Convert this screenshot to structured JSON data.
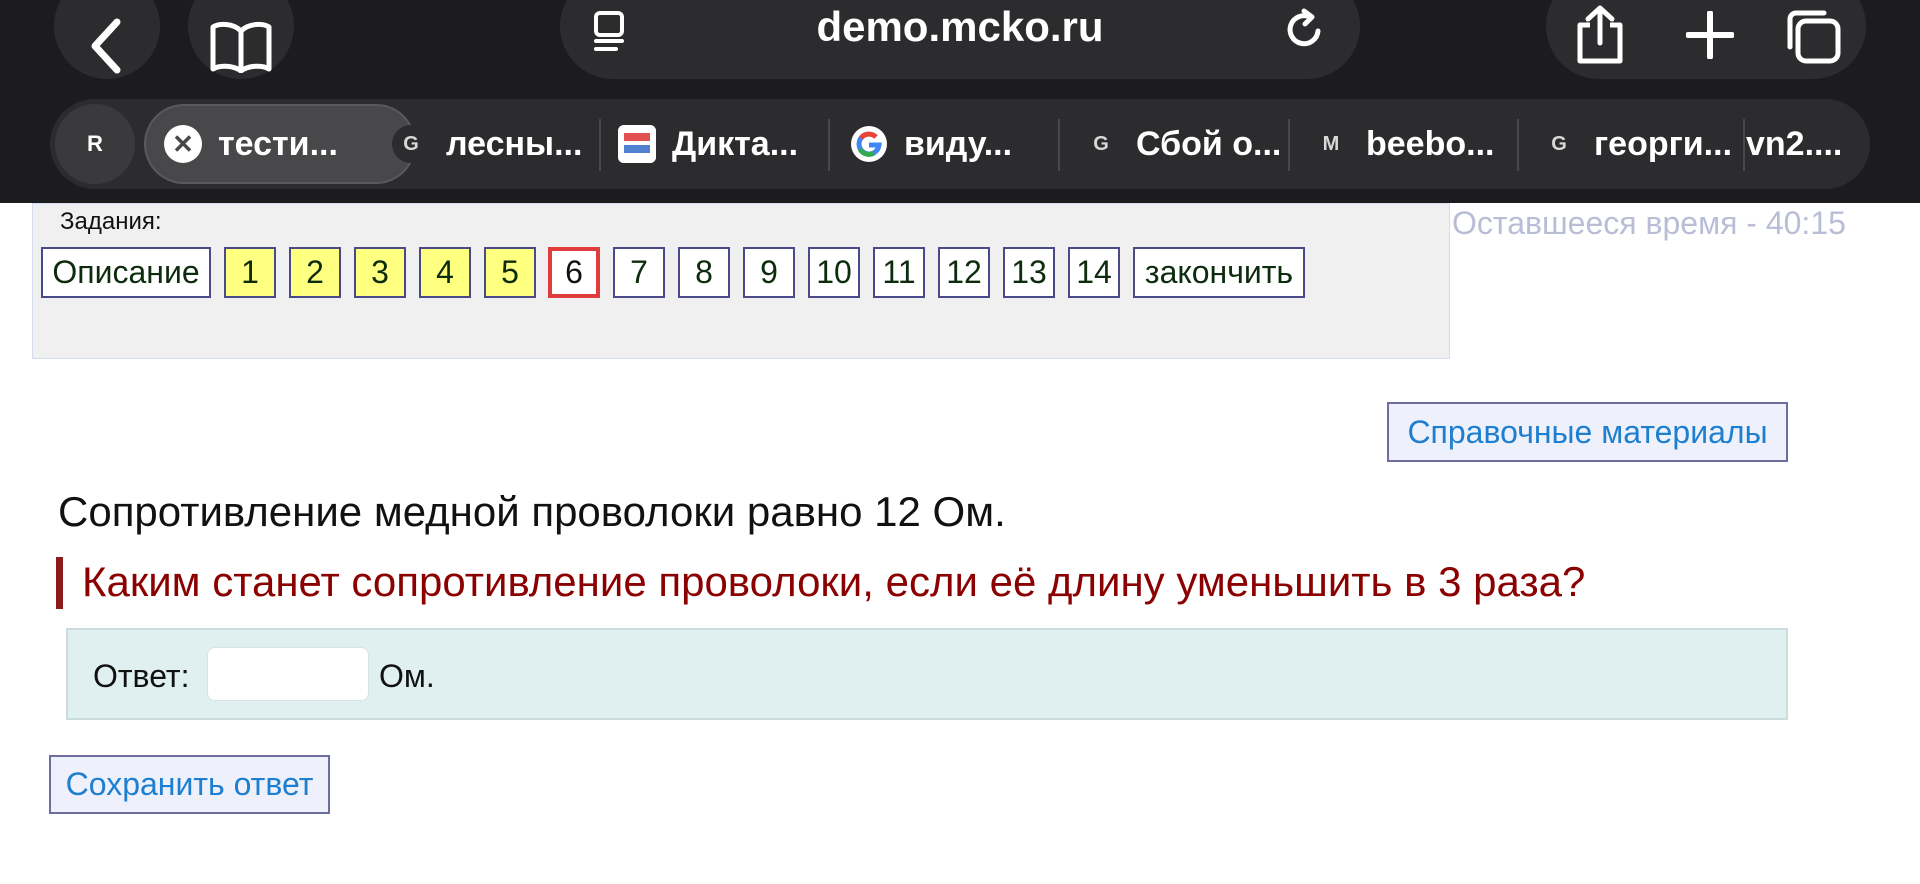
{
  "browser": {
    "url": "demo.mcko.ru",
    "profile_initial": "R",
    "tabs": [
      {
        "label": "тести...",
        "favicon": "close-icon"
      },
      {
        "label": "лесны...",
        "favicon": "G"
      },
      {
        "label": "Дикта...",
        "favicon": "diktant-favicon"
      },
      {
        "label": "виду...",
        "favicon": "google-g"
      },
      {
        "label": "Сбой о...",
        "favicon": "G"
      },
      {
        "label": "beebo...",
        "favicon": "M"
      },
      {
        "label": "георги...",
        "favicon": "G"
      },
      {
        "label": "vn2....",
        "favicon": ""
      }
    ],
    "colors": {
      "chrome_bg": "#1c1c1e",
      "control_bg": "#2c2c2e"
    }
  },
  "tasks": {
    "label": "Задания:",
    "description_label": "Описание",
    "items": [
      "1",
      "2",
      "3",
      "4",
      "5",
      "6",
      "7",
      "8",
      "9",
      "10",
      "11",
      "12",
      "13",
      "14"
    ],
    "answered": [
      "1",
      "2",
      "3",
      "4",
      "5"
    ],
    "current": "6",
    "finish_label": "закончить",
    "timer_text": "Оставшееся время - 40:15"
  },
  "reference_label": "Справочные материалы",
  "problem": {
    "statement": "Сопротивление медной проволоки равно 12 Ом.",
    "question": "Каким станет сопротивление проволоки, если её длину уменьшить в 3 раза?"
  },
  "answer": {
    "label": "Ответ:",
    "value": "",
    "unit": "Ом."
  },
  "save_label": "Сохранить ответ",
  "colors": {
    "answered_bg": "#ffff80",
    "current_border": "#e03c3c",
    "question_text": "#8b0000",
    "link_blue": "#1e7fd0",
    "answer_bg": "#e0f0f0"
  }
}
